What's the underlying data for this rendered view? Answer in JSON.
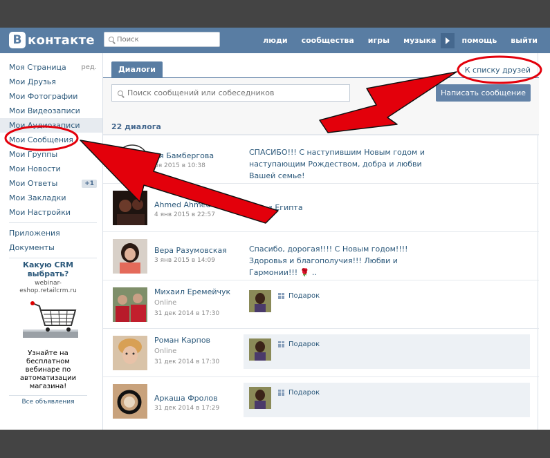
{
  "header": {
    "logo_letter": "В",
    "logo_text": "контакте",
    "search_placeholder": "Поиск",
    "nav": [
      "люди",
      "сообщества",
      "игры",
      "музыка",
      "помощь",
      "выйти"
    ]
  },
  "sidebar": {
    "items": [
      {
        "label": "Моя Страница",
        "extra": "ред."
      },
      {
        "label": "Мои Друзья",
        "extra": ""
      },
      {
        "label": "Мои Фотографии",
        "extra": ""
      },
      {
        "label": "Мои Видеозаписи",
        "extra": ""
      },
      {
        "label": "Мои Аудиозаписи",
        "extra": ""
      },
      {
        "label": "Мои Сообщения",
        "extra": ""
      },
      {
        "label": "Мои Группы",
        "extra": ""
      },
      {
        "label": "Мои Новости",
        "extra": ""
      },
      {
        "label": "Мои Ответы",
        "extra": "+1"
      },
      {
        "label": "Мои Закладки",
        "extra": ""
      },
      {
        "label": "Мои Настройки",
        "extra": ""
      }
    ],
    "extra_items": [
      "Приложения",
      "Документы"
    ],
    "ad": {
      "title": "Какую CRM выбрать?",
      "url": "webinar-eshop.retailcrm.ru",
      "text": "Узнайте на бесплатном вебинаре по автоматизации магазина!",
      "all_ads": "Все объявления"
    }
  },
  "main": {
    "tab_label": "Диалоги",
    "friends_link": "К списку друзей",
    "search_placeholder": "Поиск сообщений или собеседников",
    "write_button": "Написать сообщение",
    "count_label": "22 диалога",
    "dialogs": [
      {
        "name": "ия Бамбергова",
        "date": "ря 2015 в 10:38",
        "online": "",
        "message": "СПАСИБО!!! С наступившим Новым годом и наступающим Рождеством, добра и любви Вашей семье!"
      },
      {
        "name": "Ahmed Ahmed",
        "date": "4 янв 2015 в 22:57",
        "online": "",
        "message": "з Египта"
      },
      {
        "name": "Вера Разумовская",
        "date": "3 янв 2015 в 14:09",
        "online": "",
        "message": "Спасибо, дорогая!!!! С Новым годом!!!! Здоровья и благополучия!!! Любви и Гармонии!!! 🌹 .."
      },
      {
        "name": "Михаил Еремейчук",
        "date": "31 дек 2014 в 17:30",
        "online": "Online",
        "message": "Подарок"
      },
      {
        "name": "Роман Карпов",
        "date": "31 дек 2014 в 17:30",
        "online": "Online",
        "message": "Подарок"
      },
      {
        "name": "Аркаша Фролов",
        "date": "31 дек 2014 в 17:29",
        "online": "",
        "message": "Подарок"
      }
    ]
  },
  "colors": {
    "header_bg": "#597da3",
    "link": "#2b587a",
    "annotation_red": "#e3000b"
  }
}
